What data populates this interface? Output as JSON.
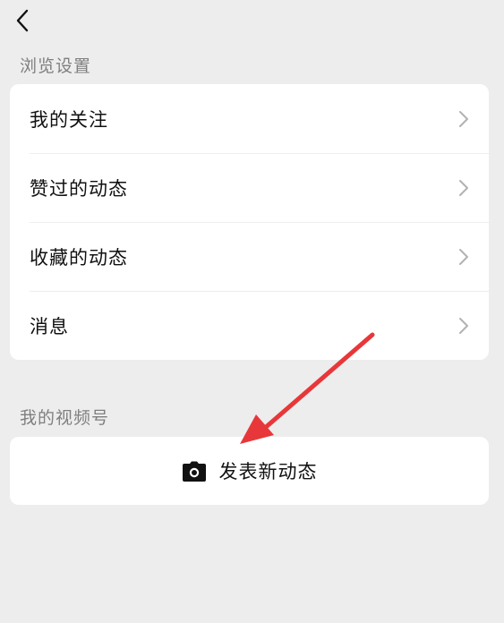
{
  "nav": {
    "back_icon": "chevron-left-icon"
  },
  "browse_settings": {
    "title": "浏览设置",
    "items": [
      {
        "label": "我的关注",
        "icon": "chevron-right-icon"
      },
      {
        "label": "赞过的动态",
        "icon": "chevron-right-icon"
      },
      {
        "label": "收藏的动态",
        "icon": "chevron-right-icon"
      },
      {
        "label": "消息",
        "icon": "chevron-right-icon"
      }
    ]
  },
  "my_channel": {
    "title": "我的视频号",
    "post_button": {
      "label": "发表新动态",
      "icon": "camera-icon"
    }
  },
  "annotation": {
    "arrow_color": "#e8373a"
  },
  "colors": {
    "background": "#ededed",
    "card": "#ffffff",
    "section_title": "#7f7f7f",
    "chevron": "#b2b2b2"
  }
}
